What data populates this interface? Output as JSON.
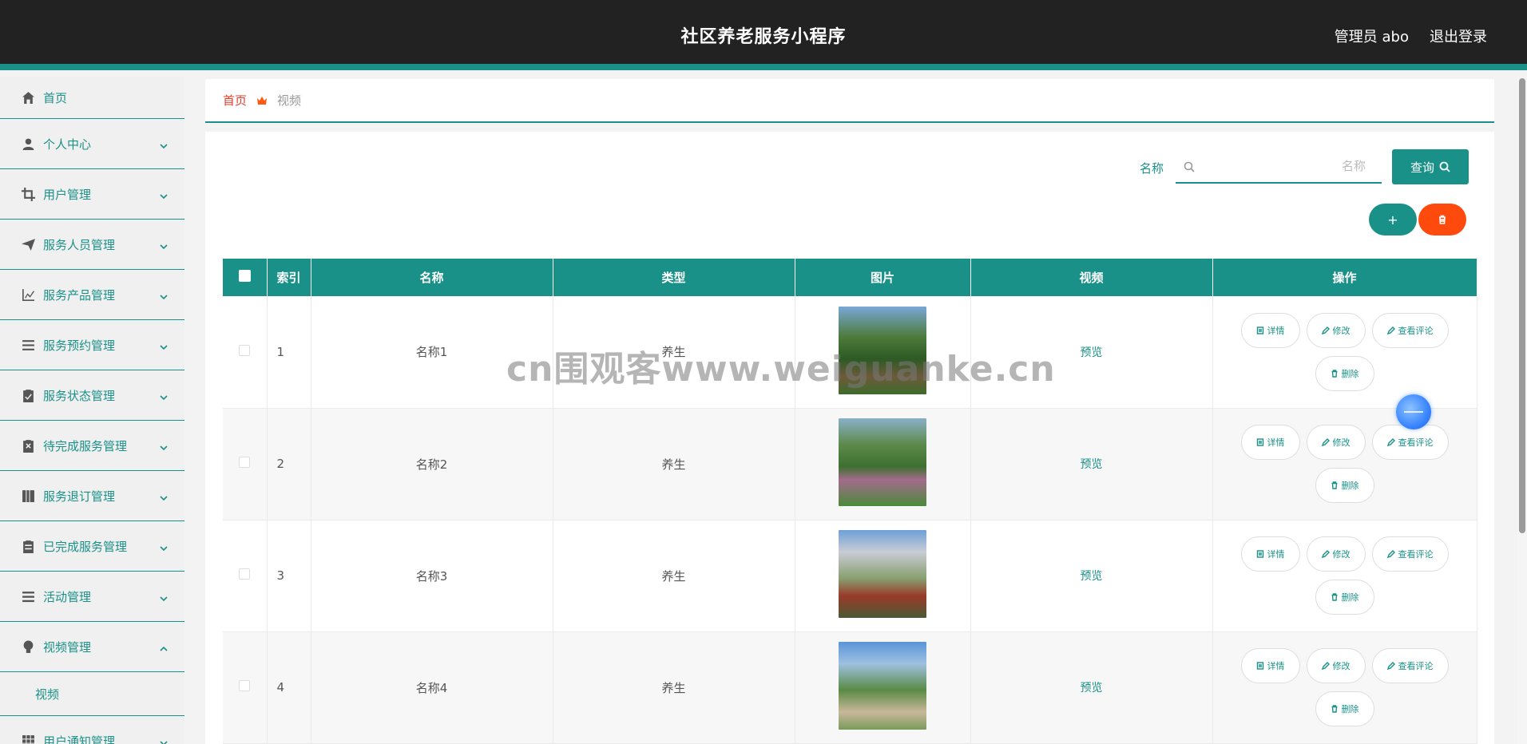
{
  "header": {
    "title": "社区养老服务小程序",
    "user": "管理员 abo",
    "logout": "退出登录"
  },
  "sidebar": {
    "items": [
      {
        "label": "首页",
        "icon": "home-icon"
      },
      {
        "label": "个人中心",
        "icon": "user-icon"
      },
      {
        "label": "用户管理",
        "icon": "crop-icon"
      },
      {
        "label": "服务人员管理",
        "icon": "send-icon"
      },
      {
        "label": "服务产品管理",
        "icon": "chart-icon"
      },
      {
        "label": "服务预约管理",
        "icon": "list-icon"
      },
      {
        "label": "服务状态管理",
        "icon": "clipboard-check-icon"
      },
      {
        "label": "待完成服务管理",
        "icon": "clipboard-x-icon"
      },
      {
        "label": "服务退订管理",
        "icon": "book-icon"
      },
      {
        "label": "已完成服务管理",
        "icon": "clipboard-icon"
      },
      {
        "label": "活动管理",
        "icon": "menu-icon"
      },
      {
        "label": "视频管理",
        "icon": "bulb-icon"
      },
      {
        "label": "用户通知管理",
        "icon": "grid-icon"
      }
    ],
    "sub_video": "视频"
  },
  "breadcrumb": {
    "home": "首页",
    "current": "视频"
  },
  "search": {
    "label": "名称",
    "placeholder": "名称",
    "button": "查询"
  },
  "toolbar": {
    "add": "+"
  },
  "table": {
    "headers": {
      "index": "索引",
      "name": "名称",
      "type": "类型",
      "image": "图片",
      "video": "视频",
      "ops": "操作"
    },
    "rows": [
      {
        "index": "1",
        "name": "名称1",
        "type": "养生",
        "video": "预览"
      },
      {
        "index": "2",
        "name": "名称2",
        "type": "养生",
        "video": "预览"
      },
      {
        "index": "3",
        "name": "名称3",
        "type": "养生",
        "video": "预览"
      },
      {
        "index": "4",
        "name": "名称4",
        "type": "养生",
        "video": "预览"
      }
    ],
    "ops": {
      "detail": "详情",
      "edit": "修改",
      "comments": "查看评论",
      "delete": "删除"
    }
  },
  "watermark": "cn围观客www.weiguanke.cn",
  "colors": {
    "accent": "#1a9188",
    "header_bg": "#222222",
    "danger": "#ff4a0d",
    "breadcrumb_home": "#e23d2a"
  }
}
